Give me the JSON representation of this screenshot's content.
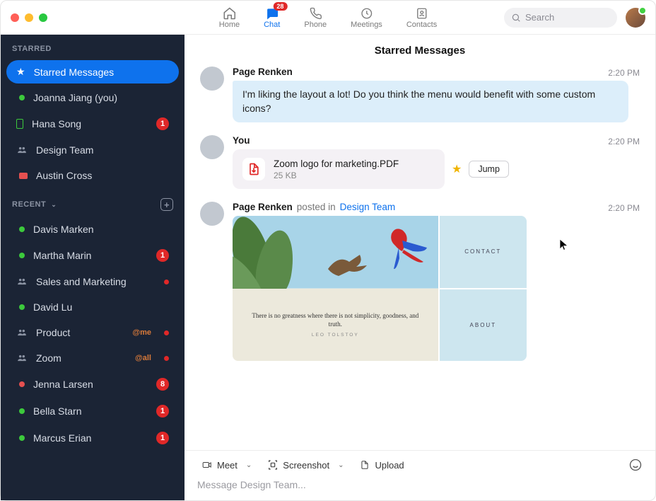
{
  "nav": {
    "home": "Home",
    "chat": "Chat",
    "chat_badge": "28",
    "phone": "Phone",
    "meetings": "Meetings",
    "contacts": "Contacts"
  },
  "search": {
    "placeholder": "Search"
  },
  "sidebar": {
    "starred_header": "STARRED",
    "recent_header": "RECENT",
    "items_starred": [
      {
        "label": "Starred Messages"
      },
      {
        "label": "Joanna Jiang (you)"
      },
      {
        "label": "Hana Song",
        "badge": "1"
      },
      {
        "label": "Design Team"
      },
      {
        "label": "Austin Cross"
      }
    ],
    "items_recent": [
      {
        "label": "Davis Marken"
      },
      {
        "label": "Martha Marin",
        "badge": "1"
      },
      {
        "label": "Sales and Marketing"
      },
      {
        "label": "David Lu"
      },
      {
        "label": "Product",
        "mention": "@me"
      },
      {
        "label": "Zoom",
        "mention": "@all"
      },
      {
        "label": "Jenna Larsen",
        "badge": "8"
      },
      {
        "label": "Bella Starn",
        "badge": "1"
      },
      {
        "label": "Marcus Erian",
        "badge": "1"
      }
    ]
  },
  "main": {
    "title": "Starred Messages",
    "messages": [
      {
        "author": "Page Renken",
        "time": "2:20 PM",
        "text": "I'm liking the layout a lot! Do you think the menu would benefit with some custom icons?"
      },
      {
        "author": "You",
        "time": "2:20 PM",
        "file": {
          "name": "Zoom logo for marketing.PDF",
          "size": "25 KB"
        },
        "jump": "Jump"
      },
      {
        "author": "Page Renken",
        "posted_in": "posted in",
        "channel": "Design Team",
        "time": "2:20 PM",
        "preview": {
          "quote": "There is no greatness where there is not simplicity, goodness, and truth.",
          "quote_author": "LEO TOLSTOY",
          "nav1": "CONTACT",
          "nav2": "ABOUT"
        }
      }
    ]
  },
  "composer": {
    "meet": "Meet",
    "screenshot": "Screenshot",
    "upload": "Upload",
    "placeholder": "Message Design Team..."
  }
}
